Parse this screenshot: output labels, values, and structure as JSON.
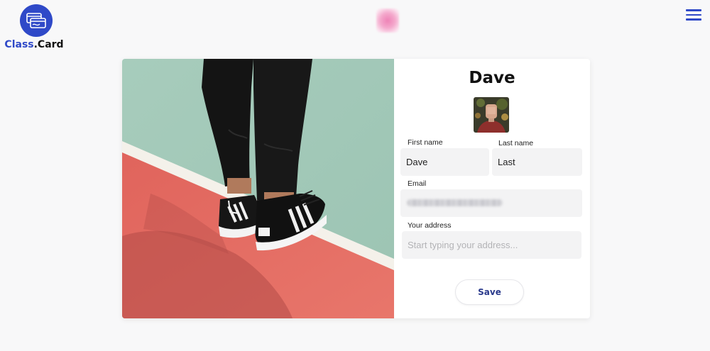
{
  "brand": {
    "name_part1": "Class",
    "name_part2": ".Card",
    "accent_color": "#2f49c8"
  },
  "header": {
    "menu_icon": "hamburger-menu-icon"
  },
  "profile": {
    "display_name": "Dave",
    "avatar_icon": "user-avatar"
  },
  "form": {
    "first_name": {
      "label": "First name",
      "value": "Dave"
    },
    "last_name": {
      "label": "Last name",
      "value": "Last"
    },
    "email": {
      "label": "Email"
    },
    "address": {
      "label": "Your address",
      "value": "",
      "placeholder": "Start typing your address..."
    },
    "save_label": "Save"
  }
}
